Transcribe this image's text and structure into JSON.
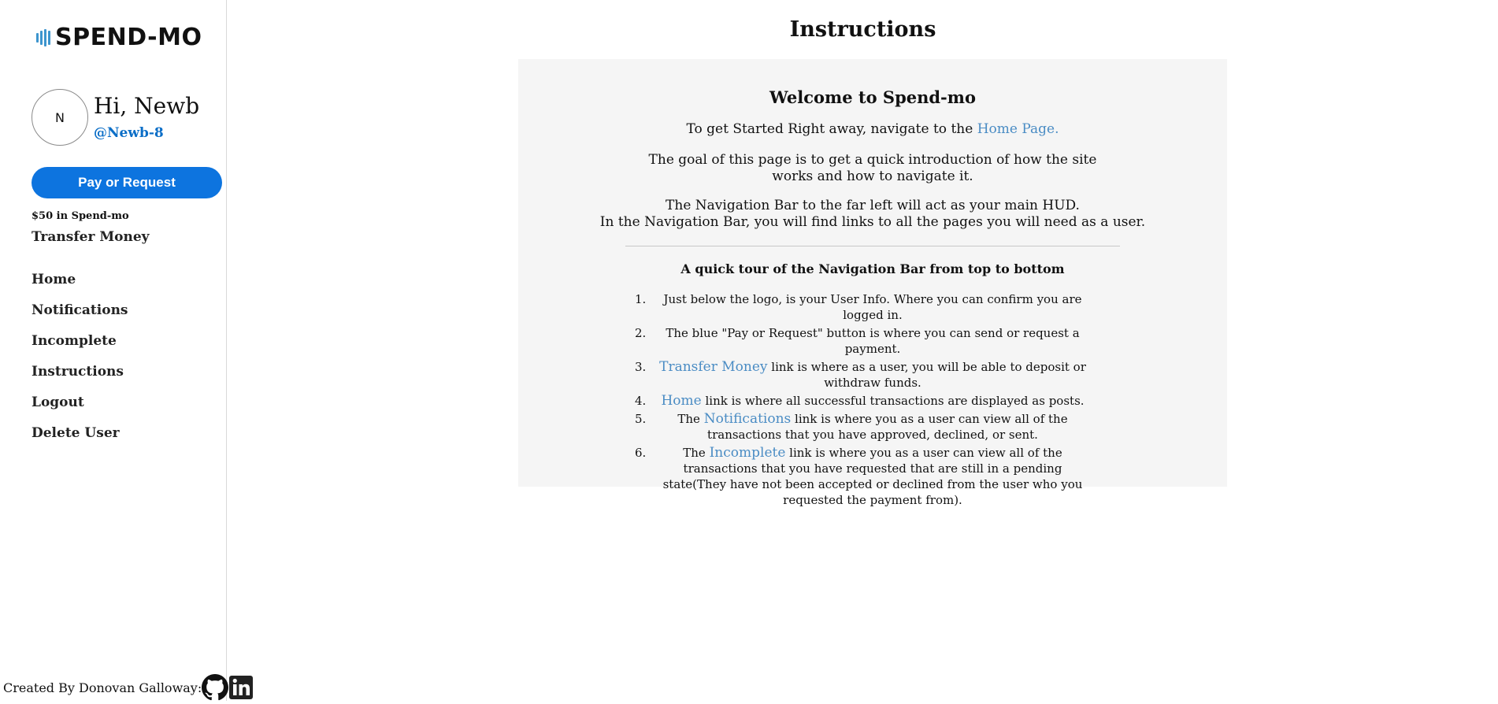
{
  "brand": {
    "name": "SPEND-MO",
    "accent": "#3d95ce"
  },
  "user": {
    "initial": "N",
    "greeting": "Hi, Newb",
    "handle": "@Newb-8"
  },
  "sidebar": {
    "pay_button": "Pay or Request",
    "balance": "$50 in Spend-mo",
    "transfer_link": "Transfer Money",
    "nav": [
      "Home",
      "Notifications",
      "Incomplete",
      "Instructions",
      "Logout",
      "Delete User"
    ],
    "footer": "Created By Donovan Galloway:"
  },
  "main": {
    "title": "Instructions",
    "welcome": "Welcome to Spend-mo",
    "intro_prefix": "To get Started Right away, navigate to the ",
    "intro_link": "Home Page.",
    "goal": "The goal of this page is to get a quick introduction of how the site works and how to navigate it.",
    "navbar_line1": "The Navigation Bar to the far left will act as your main HUD.",
    "navbar_line2": "In the Navigation Bar, you will find links to all the pages you will need as a user.",
    "tour_title": "A quick tour of the Navigation Bar from top to bottom",
    "tour": [
      {
        "num": "1.",
        "pre": "",
        "link": "",
        "post": "Just below the logo, is your User Info. Where you can confirm you are logged in."
      },
      {
        "num": "2.",
        "pre": "",
        "link": "",
        "post": "The blue \"Pay or Request\" button is where you can send or request a payment."
      },
      {
        "num": "3.",
        "pre": "",
        "link": "Transfer Money",
        "post": " link is where as a user, you will be able to deposit or withdraw funds."
      },
      {
        "num": "4.",
        "pre": "",
        "link": "Home",
        "post": " link is where all successful transactions are displayed as posts."
      },
      {
        "num": "5.",
        "pre": "The ",
        "link": "Notifications",
        "post": " link is where you as a user can view all of the transactions that you have approved, declined, or sent."
      },
      {
        "num": "6.",
        "pre": "The ",
        "link": "Incomplete",
        "post": " link is where you as a user can view all of the transactions that you have requested that are still in a pending state(They have not been accepted or declined from the user who you requested the payment from)."
      }
    ]
  },
  "icons": [
    "github-icon",
    "linkedin-icon"
  ],
  "colors": {
    "button": "#0d74df",
    "handle": "#0b6ec7",
    "link": "#4a8cc4",
    "card_bg": "#f5f5f5"
  }
}
